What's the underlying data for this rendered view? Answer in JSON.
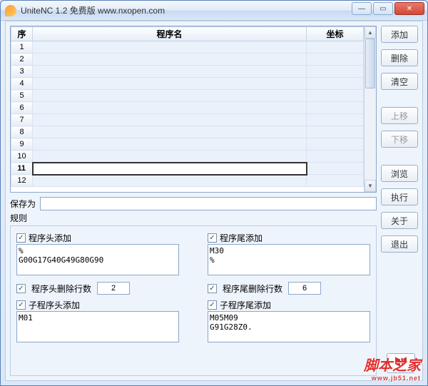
{
  "title": "UniteNC 1.2    免费版      www.nxopen.com",
  "columns": {
    "seq": "序",
    "name": "程序名",
    "coord": "坐标"
  },
  "rows": [
    1,
    2,
    3,
    4,
    5,
    6,
    7,
    8,
    9,
    10,
    11,
    12
  ],
  "selected_row": 11,
  "buttons": {
    "add": "添加",
    "delete": "删除",
    "clear": "清空",
    "moveup": "上移",
    "movedown": "下移",
    "browse": "浏览",
    "execute": "执行",
    "about": "关于",
    "exit": "退出"
  },
  "save_as_label": "保存为",
  "save_as_value": "",
  "rules_label": "规则",
  "rules": {
    "head_add": {
      "label": "程序头添加",
      "checked": true,
      "value": "%\nG00G17G40G49G80G90"
    },
    "tail_add": {
      "label": "程序尾添加",
      "checked": true,
      "value": "M30\n%"
    },
    "head_del": {
      "label": "程序头删除行数",
      "checked": true,
      "value": "2"
    },
    "tail_del": {
      "label": "程序尾删除行数",
      "checked": true,
      "value": "6"
    },
    "sub_head": {
      "label": "子程序头添加",
      "checked": true,
      "value": "M01"
    },
    "sub_tail": {
      "label": "子程序尾添加",
      "checked": true,
      "value": "M05M09\nG91G28Z0."
    }
  },
  "watermark": {
    "text": "脚本之家",
    "url": "www.jb51.net"
  }
}
